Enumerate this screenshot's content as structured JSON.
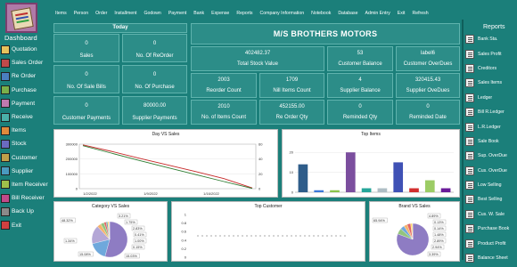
{
  "menu": [
    "Items",
    "Person",
    "Order",
    "Installment",
    "Godown",
    "Payment",
    "Bank",
    "Expense",
    "Reports",
    "Company Information",
    "Notebook",
    "Database",
    "Admin Entry",
    "Exit",
    "Refresh"
  ],
  "left_title": "Dashboard",
  "left_nav": [
    "Quotation",
    "Sales Order",
    "Re Order",
    "Purchase",
    "Payment",
    "Receive",
    "Items",
    "Stock",
    "Customer",
    "Supplier",
    "Item Receiver",
    "Bill Receiver",
    "Back Up",
    "Exit"
  ],
  "today": "Today",
  "company": "M/S BROTHERS MOTORS",
  "tiles": [
    {
      "v": "0",
      "l": "Sales"
    },
    {
      "v": "0",
      "l": "No. Of ReOrder"
    },
    {
      "v": "0",
      "l": "No. Of Sale Bills"
    },
    {
      "v": "0",
      "l": "No. Of Purchase"
    },
    {
      "v": "0",
      "l": "Customer Payments"
    },
    {
      "v": "80000.00",
      "l": "Supplier Payments"
    },
    {
      "v": "402482.37",
      "l": "Total Stock Value"
    },
    {
      "v": "53",
      "l": "Customer Balance"
    },
    {
      "v": "label6",
      "l": "Customer OverDues"
    },
    {
      "v": "2003",
      "l": "Reorder Count"
    },
    {
      "v": "1709",
      "l": "Nill Items Count"
    },
    {
      "v": "4",
      "l": "Supplier Balance"
    },
    {
      "v": "320415.43",
      "l": "Supplier OveDues"
    },
    {
      "v": "2010",
      "l": "No. of Items Count"
    },
    {
      "v": "452155.00",
      "l": "Re Order Qty"
    },
    {
      "v": "0",
      "l": "Reminded Qty"
    },
    {
      "v": "0",
      "l": "Reminded Date"
    }
  ],
  "reports_title": "Reports",
  "right_nav": [
    "Bank Sta.",
    "Sales Profit",
    "Creditors",
    "Sales Items",
    "Ledger",
    "Bill R.Ledger",
    "L.R.Ledger",
    "Sale Book",
    "Sup. OverDue",
    "Cus. OverDue",
    "Low Selling",
    "Best Selling",
    "Cus. W. Sale",
    "Purchase Book",
    "Product Profit",
    "Balance Sheet"
  ],
  "chart_data": [
    {
      "type": "line",
      "title": "Day VS Sales",
      "x": [
        "1/2/2022",
        "1/9/2022",
        "1/16/2022"
      ],
      "ylim": [
        0,
        300000
      ],
      "y_ticks": [
        "300000",
        "200000",
        "100000",
        "0"
      ],
      "y2_ticks": [
        "60",
        "40",
        "20",
        "0"
      ],
      "series": [
        {
          "color": "#c62828",
          "values": [
            295000,
            252000,
            205000,
            160000,
            115000,
            68000,
            5000
          ]
        },
        {
          "color": "#2e7d32",
          "values": [
            290000,
            240000,
            190000,
            142000,
            95000,
            48000,
            2000
          ]
        }
      ]
    },
    {
      "type": "bar",
      "title": "Top Items",
      "ylim": [
        0,
        25
      ],
      "y_ticks": [
        "20",
        "10",
        "0"
      ],
      "values": [
        14,
        1,
        1,
        20,
        2,
        2,
        15,
        2,
        6,
        2
      ],
      "colors": [
        "#2f5d8a",
        "#3c78d8",
        "#8bc34a",
        "#7b4e9e",
        "#26a69a",
        "#b0bec5",
        "#3f51b5",
        "#d32f2f",
        "#9ccc65",
        "#6a1b9a"
      ]
    },
    {
      "type": "pie",
      "title": "Category VS Sales",
      "labels": [
        "48.32%",
        "3.21%",
        "15.08%",
        "1.75%",
        "2.83%",
        "0.41%",
        "1.00%",
        "0.15%",
        "15.03%",
        "1.34%"
      ],
      "values": [
        48.32,
        15.08,
        15.03,
        3.21,
        2.83,
        1.75,
        1.34,
        1.0,
        0.41,
        0.15
      ]
    },
    {
      "type": "line",
      "title": "Top Customer",
      "y_ticks": [
        "1",
        "0.8",
        "0.6",
        "0.4",
        "0.2",
        "0"
      ],
      "series": []
    },
    {
      "type": "pie",
      "title": "Brand VS Sales",
      "labels": [
        "65.94%",
        "4.89%",
        "0.13%",
        "0.14%",
        "1.48%",
        "2.89%",
        "2.94%",
        "3.39%"
      ],
      "values": [
        65.94,
        4.89,
        3.39,
        2.94,
        2.89,
        1.48,
        0.14,
        0.13
      ]
    }
  ]
}
